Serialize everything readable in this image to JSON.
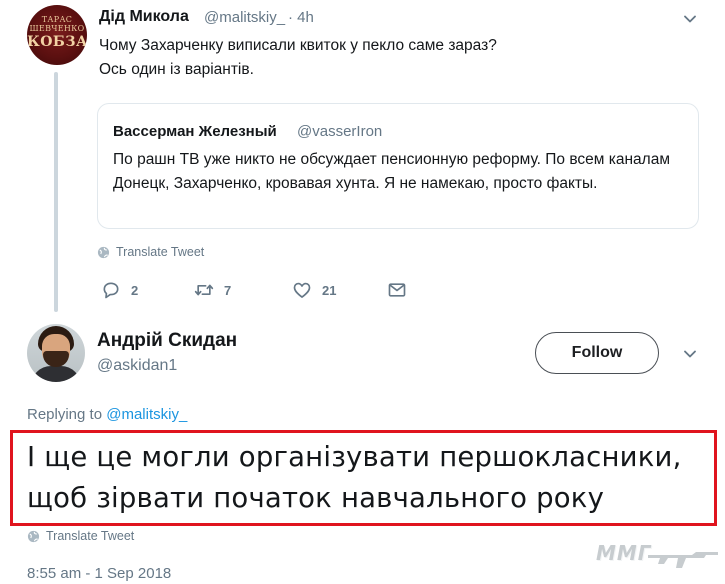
{
  "parent_tweet": {
    "author_name": "Дід Микола",
    "author_handle": "@malitskiy_",
    "time": "· 4h",
    "text": "Чому Захарченку виписали квиток у пекло саме зараз?\nОсь один із варіантів.",
    "avatar_logo_top": "ТАРАС\nШЕВЧЕНКО",
    "avatar_logo_main": "КОБЗАР",
    "quote": {
      "author_name": "Вассерман Железный",
      "author_handle": "@vasserIron",
      "text": "По рашн ТВ уже никто не обсуждает пенсионную реформу. По всем каналам Донецк, Захарченко, кровавая хунта. Я не намекаю, просто факты."
    },
    "translate_label": "Translate Tweet",
    "actions": {
      "replies": "2",
      "retweets": "7",
      "likes": "21"
    }
  },
  "reply_tweet": {
    "author_name": "Андрій Скидан",
    "author_handle": "@askidan1",
    "follow_label": "Follow",
    "replying_prefix": "Replying to ",
    "replying_mention": "@malitskiy_",
    "text": "І ще це могли організувати першокласники, щоб зірвати початок навчального року",
    "translate_label": "Translate Tweet",
    "timestamp": "8:55 am - 1 Sep 2018"
  },
  "watermark": {
    "text": "ММГ"
  },
  "colors": {
    "text": "#14171a",
    "secondary": "#657786",
    "link": "#1b95e0",
    "highlight_border": "#e0141e",
    "divider": "#e1e8ed"
  }
}
